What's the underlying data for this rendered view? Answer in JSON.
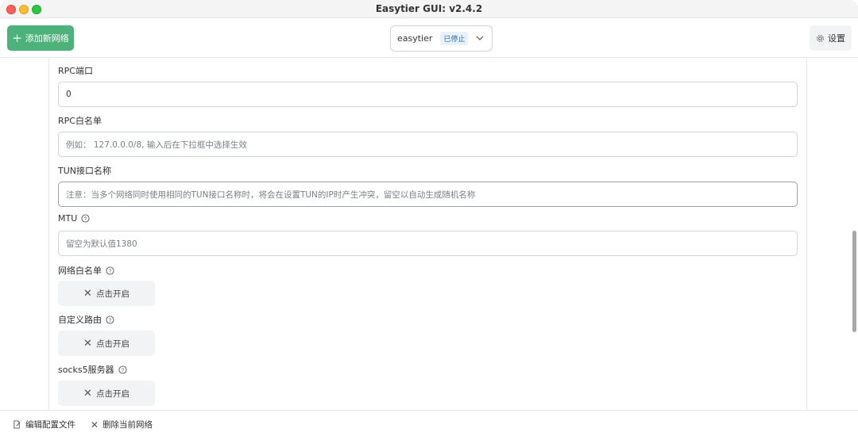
{
  "window": {
    "title": "Easytier GUI: v2.4.2"
  },
  "toolbar": {
    "add_network_label": "添加新网络",
    "network_name": "easytier",
    "network_status": "已停止",
    "settings_label": "设置"
  },
  "form": {
    "rpc_port": {
      "label": "RPC端口",
      "value": "0"
    },
    "rpc_whitelist": {
      "label": "RPC白名单",
      "placeholder": "例如： 127.0.0.0/8, 输入后在下拉框中选择生效"
    },
    "tun_name": {
      "label": "TUN接口名称",
      "placeholder": "注意：当多个网络同时使用相同的TUN接口名称时，将会在设置TUN的IP时产生冲突，留空以自动生成随机名称"
    },
    "mtu": {
      "label": "MTU",
      "placeholder": "留空为默认值1380"
    },
    "network_whitelist": {
      "label": "网络白名单",
      "button": "点击开启"
    },
    "custom_routes": {
      "label": "自定义路由",
      "button": "点击开启"
    },
    "socks5": {
      "label": "socks5服务器",
      "button": "点击开启"
    }
  },
  "footer": {
    "edit_config_label": "编辑配置文件",
    "delete_network_label": "删除当前网络"
  },
  "colors": {
    "accent_green": "#4cb27a",
    "status_badge_bg": "#e8f2fc",
    "status_badge_text": "#2b6cb0"
  },
  "icons": [
    "plus-icon",
    "chevron-down-icon",
    "gear-icon",
    "help-circle-icon",
    "close-icon",
    "edit-file-icon"
  ]
}
